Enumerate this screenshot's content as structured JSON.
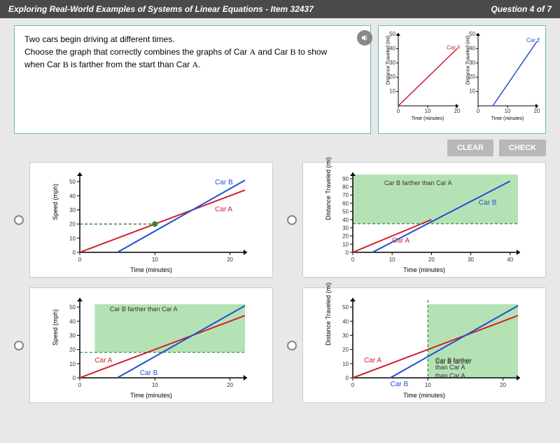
{
  "header": {
    "title": "Exploring Real-World Examples of Systems of Linear Equations - Item 32437",
    "progress": "Question 4 of 7"
  },
  "question": {
    "line1": "Two cars begin driving at different times.",
    "line2_a": "Choose the graph that correctly combines the graphs of Car ",
    "line2_b": " and Car ",
    "line2_c": " to show",
    "line3_a": "when Car ",
    "line3_b": " is farther from the start than Car ",
    "carA": "A",
    "carB": "B"
  },
  "buttons": {
    "clear": "CLEAR",
    "check": "CHECK"
  },
  "labels": {
    "carA": "Car A",
    "carB": "Car B",
    "farther": "Car B farther than Car A"
  },
  "axes": {
    "time": "Time (minutes)",
    "speed": "Speed (mph)",
    "distance": "Distance Traveled (mi)"
  },
  "ref": {
    "carA": {
      "xlabel": "Time (minutes)",
      "ylabel": "Distance Traveled (mi)",
      "xticks": [
        0,
        10,
        20
      ],
      "yticks": [
        0,
        10,
        20,
        30,
        40,
        50
      ],
      "line": [
        [
          0,
          0
        ],
        [
          20,
          40
        ]
      ],
      "color": "#d02030",
      "label": "Car A"
    },
    "carB": {
      "xlabel": "Time (minutes)",
      "ylabel": "Distance Traveled (mi)",
      "xticks": [
        0,
        10,
        20
      ],
      "yticks": [
        0,
        10,
        20,
        30,
        40,
        50
      ],
      "line": [
        [
          5,
          0
        ],
        [
          20,
          45
        ]
      ],
      "color": "#2050d0",
      "label": "Car B"
    }
  },
  "chart_data": [
    {
      "id": "opt1",
      "ylabel": "Speed (mph)",
      "xlabel": "Time (minutes)",
      "xlim": [
        0,
        22
      ],
      "ylim": [
        0,
        55
      ],
      "xticks": [
        0,
        10,
        20
      ],
      "yticks": [
        0,
        10,
        20,
        30,
        40,
        50
      ],
      "series": [
        {
          "name": "Car A",
          "color": "#d02030",
          "points": [
            [
              0,
              0
            ],
            [
              22,
              44
            ]
          ]
        },
        {
          "name": "Car B",
          "color": "#2050d0",
          "points": [
            [
              5,
              0
            ],
            [
              22,
              51
            ]
          ]
        }
      ],
      "intersection": [
        10,
        20
      ],
      "dash_to_y": true,
      "dash_color": "#2a8a2a"
    },
    {
      "id": "opt2",
      "ylabel": "Distance Traveled (mi)",
      "xlabel": "Time (minutes)",
      "xlim": [
        0,
        42
      ],
      "ylim": [
        0,
        95
      ],
      "xticks": [
        0,
        10,
        20,
        30,
        40
      ],
      "yticks": [
        0,
        10,
        20,
        30,
        40,
        50,
        60,
        70,
        80,
        90
      ],
      "series": [
        {
          "name": "Car A",
          "color": "#d02030",
          "points": [
            [
              0,
              0
            ],
            [
              20,
              40
            ]
          ]
        },
        {
          "name": "Car B",
          "color": "#2050d0",
          "points": [
            [
              5,
              0
            ],
            [
              40,
              87
            ]
          ]
        }
      ],
      "shade": {
        "x0": 0,
        "x1": 42,
        "y0": 35,
        "y1": 95,
        "label": "Car B farther than Car A"
      },
      "dash_h": 35
    },
    {
      "id": "opt3",
      "ylabel": "Speed (mph)",
      "xlabel": "Time (minutes)",
      "xlim": [
        0,
        22
      ],
      "ylim": [
        0,
        55
      ],
      "xticks": [
        0,
        10,
        20
      ],
      "yticks": [
        0,
        10,
        20,
        30,
        40,
        50
      ],
      "series": [
        {
          "name": "Car A",
          "color": "#d02030",
          "points": [
            [
              0,
              0
            ],
            [
              22,
              44
            ]
          ]
        },
        {
          "name": "Car B",
          "color": "#2050d0",
          "points": [
            [
              5,
              0
            ],
            [
              22,
              51
            ]
          ]
        }
      ],
      "shade": {
        "x0": 2,
        "x1": 22,
        "y0": 18,
        "y1": 52,
        "label": "Car B farther than Car A"
      },
      "dash_h": 18
    },
    {
      "id": "opt4",
      "ylabel": "Distance Traveled (mi)",
      "xlabel": "Time (minutes)",
      "xlim": [
        0,
        22
      ],
      "ylim": [
        0,
        55
      ],
      "xticks": [
        0,
        10,
        20
      ],
      "yticks": [
        0,
        10,
        20,
        30,
        40,
        50
      ],
      "series": [
        {
          "name": "Car A",
          "color": "#d02030",
          "points": [
            [
              0,
              0
            ],
            [
              22,
              44
            ]
          ]
        },
        {
          "name": "Car B",
          "color": "#2050d0",
          "points": [
            [
              5,
              0
            ],
            [
              22,
              51
            ]
          ]
        }
      ],
      "shade": {
        "x0": 10,
        "x1": 22,
        "y0": 0,
        "y1": 52,
        "label": "Car B farther\nthan Car A"
      },
      "dash_v": 10
    }
  ]
}
